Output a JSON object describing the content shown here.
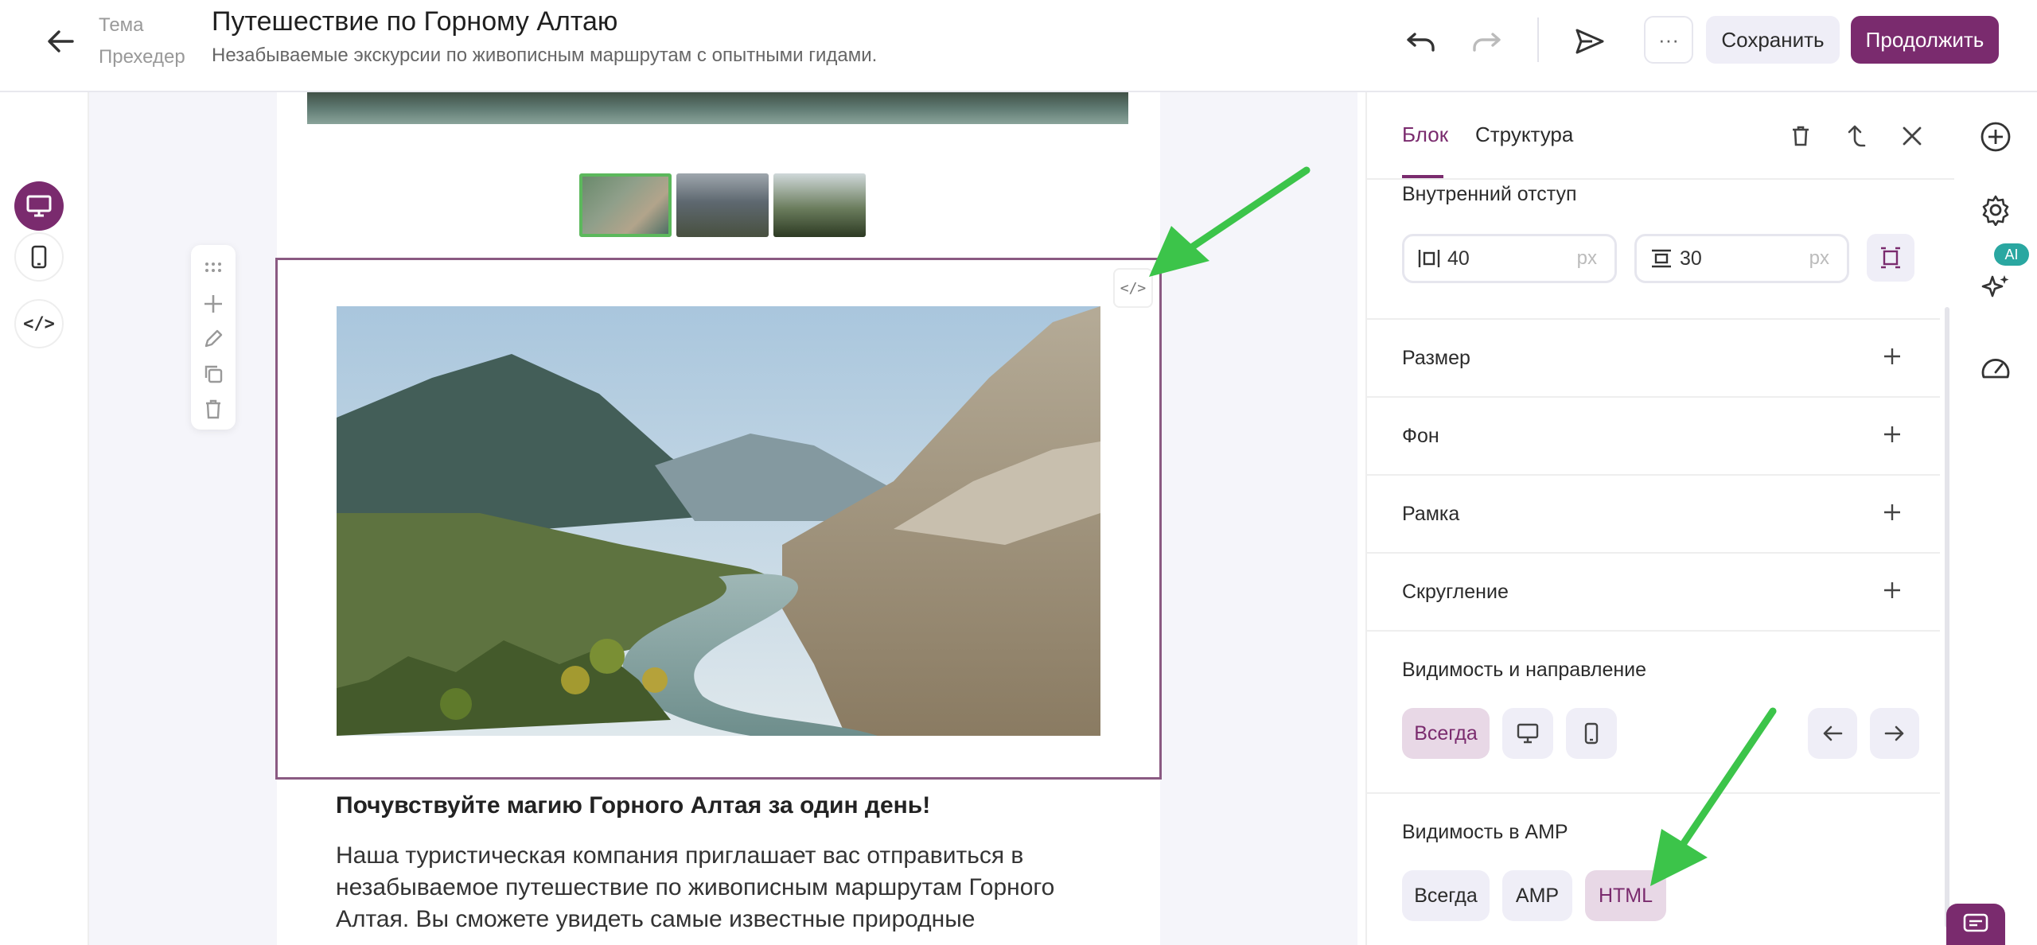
{
  "header": {
    "theme_label": "Тема",
    "preheader_label": "Прехедер",
    "title": "Путешествие по Горному Алтаю",
    "preheader": "Незабываемые экскурсии по живописным маршрутам с опытными гидами.",
    "dots": "···",
    "save": "Сохранить",
    "continue": "Продолжить"
  },
  "left": {
    "code_tag": "</>"
  },
  "canvas": {
    "code_chip": "</>",
    "headline": "Почувствуйте магию Горного Алтая за один день!",
    "paragraph": "Наша туристическая компания приглашает вас отправиться в незабываемое путешествие по живописным маршрутам Горного Алтая. Вы сможете увидеть самые известные природные"
  },
  "panel": {
    "tab_block": "Блок",
    "tab_structure": "Структура",
    "inner_padding": "Внутренний отступ",
    "pad_horizontal": "40",
    "pad_vertical": "30",
    "unit": "px",
    "size": "Размер",
    "background": "Фон",
    "border": "Рамка",
    "rounding": "Скругление",
    "visibility_direction": "Видимость и направление",
    "always": "Всегда",
    "amp_visibility": "Видимость в AMP",
    "amp_always": "Всегда",
    "amp": "AMP",
    "html": "HTML"
  },
  "rail": {
    "ai": "AI"
  },
  "colors": {
    "accent": "#7a2b6e",
    "selected_pill_bg": "#e8d8e6",
    "annotation_arrow": "#3cc44a"
  }
}
